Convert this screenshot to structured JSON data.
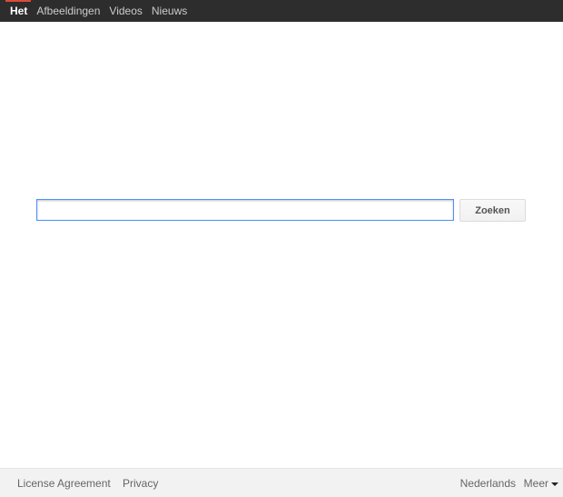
{
  "topbar": {
    "tabs": [
      {
        "label": "Het",
        "active": true
      },
      {
        "label": "Afbeeldingen",
        "active": false
      },
      {
        "label": "Videos",
        "active": false
      },
      {
        "label": "Nieuws",
        "active": false
      }
    ],
    "active_color": "#dd4b39",
    "background": "#2d2d2d"
  },
  "search": {
    "value": "",
    "placeholder": "",
    "button_label": "Zoeken"
  },
  "footer": {
    "license_label": "License Agreement",
    "privacy_label": "Privacy",
    "language_label": "Nederlands",
    "more_label": "Meer",
    "more_icon": "caret-down-icon"
  }
}
